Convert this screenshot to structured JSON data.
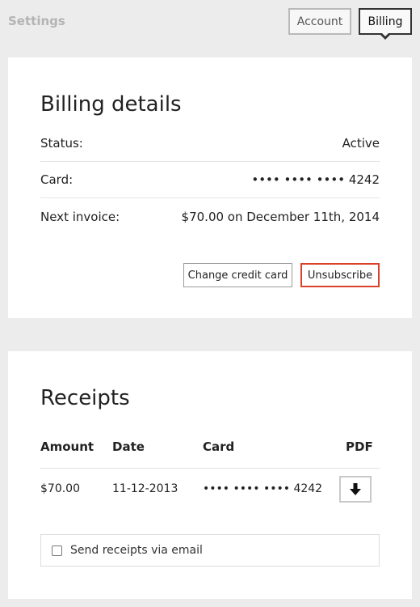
{
  "header": {
    "title": "Settings",
    "tabs": [
      {
        "label": "Account",
        "active": false
      },
      {
        "label": "Billing",
        "active": true
      }
    ]
  },
  "billing": {
    "title": "Billing details",
    "rows": [
      {
        "label": "Status:",
        "value": "Active"
      },
      {
        "label": "Card:",
        "value": "•••• •••• •••• 4242"
      },
      {
        "label": "Next invoice:",
        "value": "$70.00 on December 11th, 2014"
      }
    ],
    "change_card_label": "Change credit card",
    "unsubscribe_label": "Unsubscribe"
  },
  "receipts": {
    "title": "Receipts",
    "columns": [
      "Amount",
      "Date",
      "Card",
      "PDF"
    ],
    "rows": [
      {
        "amount": "$70.00",
        "date": "11-12-2013",
        "card": "•••• •••• •••• 4242",
        "pdf_icon": "download-arrow-icon"
      }
    ],
    "email_option": {
      "label": "Send receipts via email",
      "checked": false
    }
  },
  "colors": {
    "background": "#ececec",
    "accent_danger": "#d9412a",
    "active_tab_border": "#333333"
  }
}
